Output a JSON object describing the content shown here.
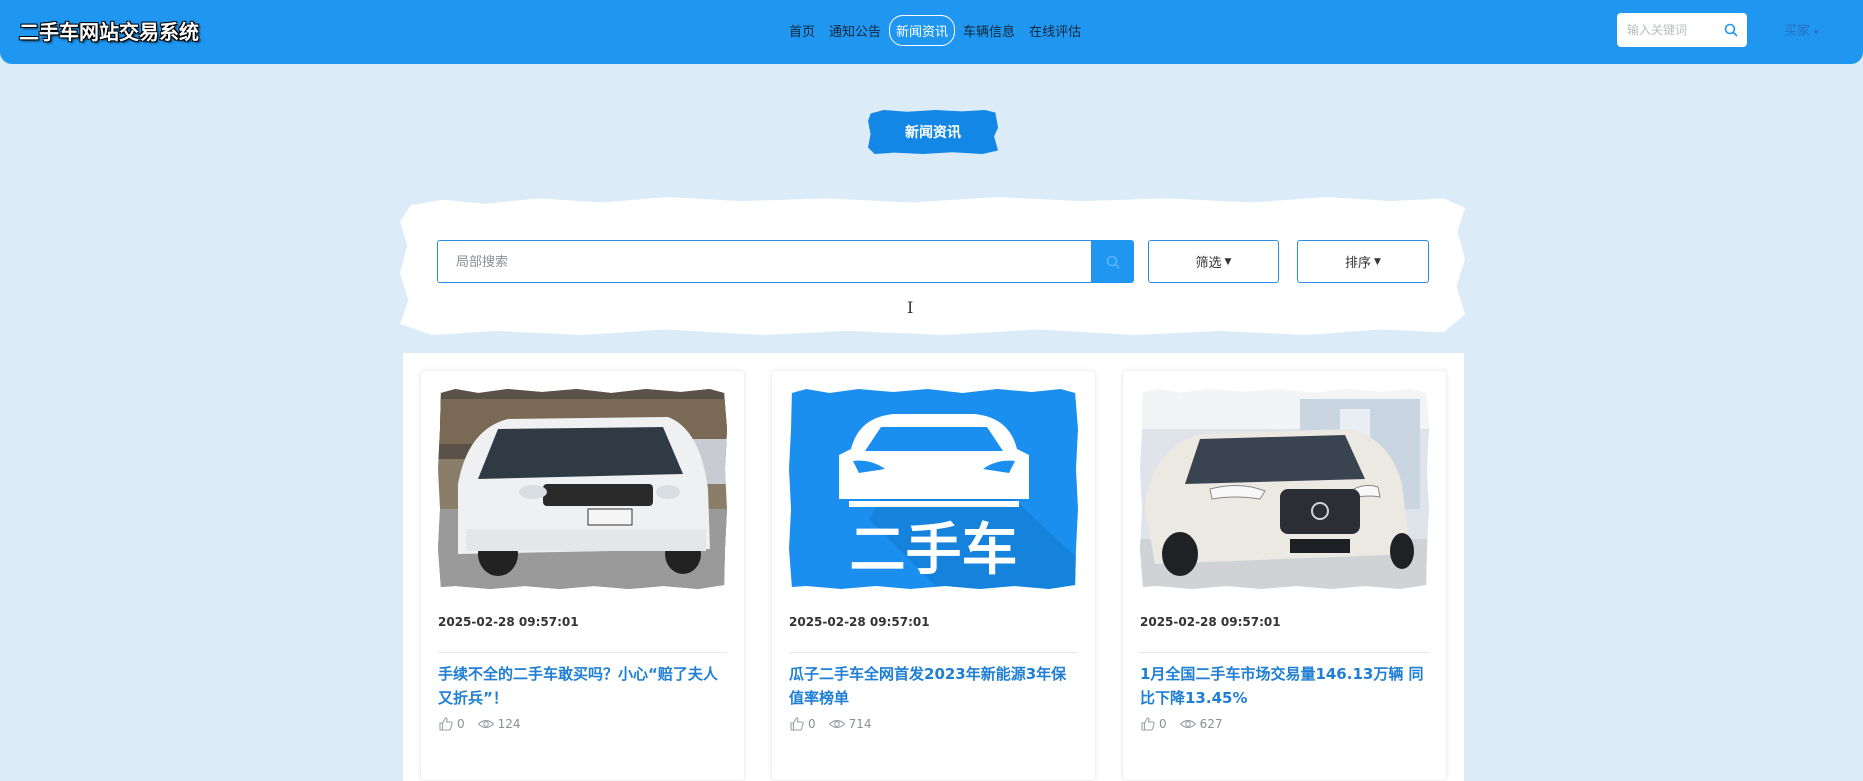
{
  "header": {
    "site_title": "二手车网站交易系统",
    "nav": [
      {
        "label": "首页",
        "active": false
      },
      {
        "label": "通知公告",
        "active": false
      },
      {
        "label": "新闻资讯",
        "active": true
      },
      {
        "label": "车辆信息",
        "active": false
      },
      {
        "label": "在线评估",
        "active": false
      }
    ],
    "search_placeholder": "输入关键词",
    "user_menu_label": "买家"
  },
  "section_title": "新闻资讯",
  "filters": {
    "search_placeholder": "局部搜索",
    "filter_label": "筛选",
    "sort_label": "排序"
  },
  "colors": {
    "header_bg": "#1f97f1",
    "accent": "#1287e6",
    "title_link": "#1f7fd4",
    "page_bg": "#dcebf8"
  },
  "news": [
    {
      "date": "2025-02-28 09:57:01",
      "title": "手续不全的二手车敢买吗？小心“赔了夫人又折兵”！",
      "likes": "0",
      "views": "124",
      "image": "white-minivan-photo"
    },
    {
      "date": "2025-02-28 09:57:01",
      "title": "瓜子二手车全网首发2023年新能源3年保值率榜单",
      "likes": "0",
      "views": "714",
      "image": "used-car-logo",
      "image_text": "二手车"
    },
    {
      "date": "2025-02-28 09:57:01",
      "title": "1月全国二手车市场交易量146.13万辆 同比下降13.45%",
      "likes": "0",
      "views": "627",
      "image": "white-suv-photo"
    }
  ]
}
